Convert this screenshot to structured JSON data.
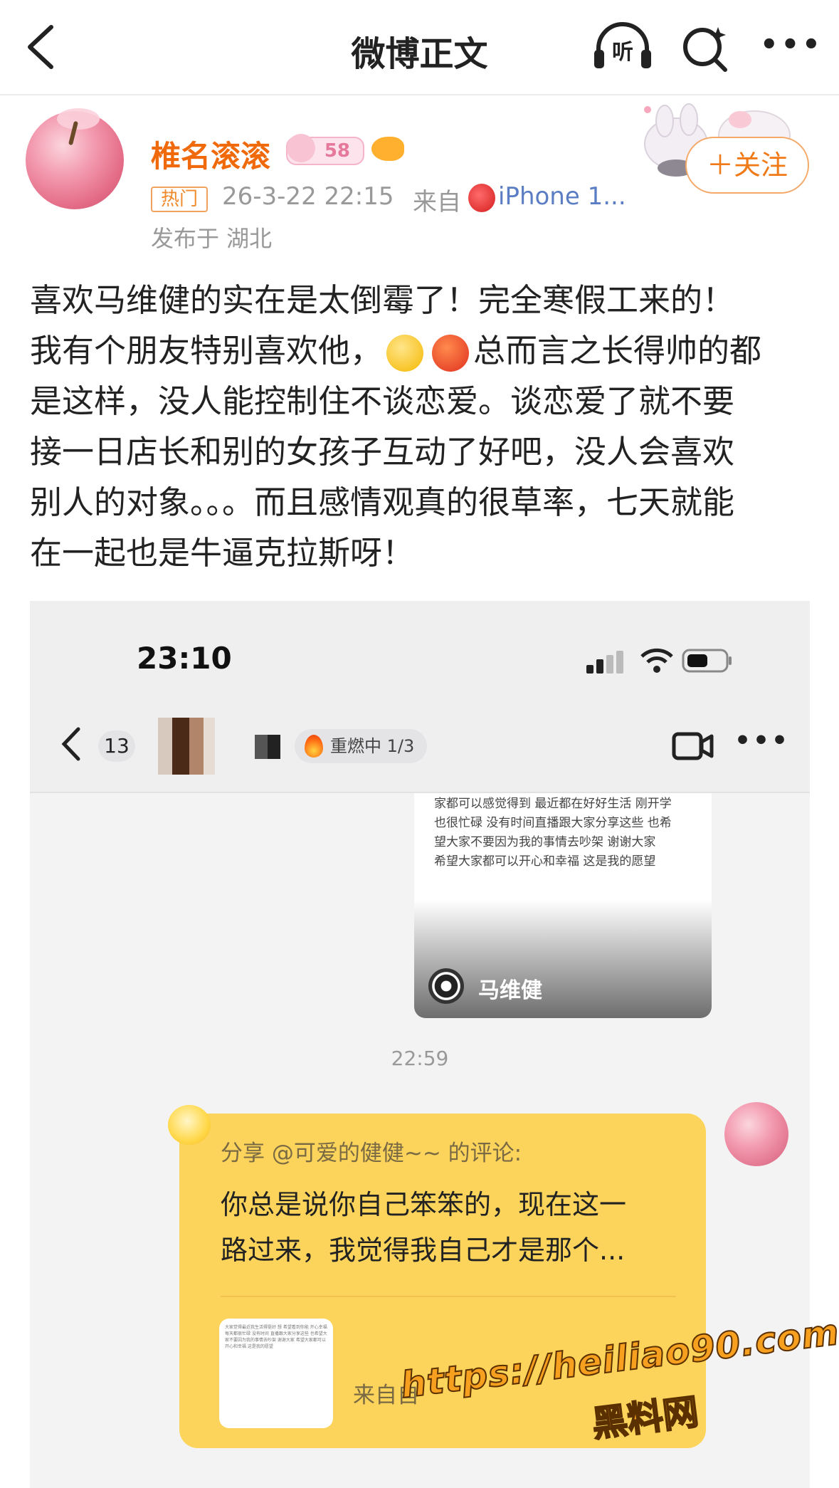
{
  "nav": {
    "title": "微博正文",
    "listen_label": "听"
  },
  "author": {
    "name": "椎名滚滚",
    "level_badge": "58",
    "hot_tag": "热门",
    "time": "26-3-22 22:15",
    "from_prefix": "来自",
    "device": "iPhone 1...",
    "location": "发布于 湖北",
    "follow_label": "＋关注"
  },
  "post": {
    "line1": "喜欢马维健的实在是太倒霉了！完全寒假工来的！",
    "line2_a": "我有个朋友特别喜欢他，",
    "line2_b": "总而言之长得帅的都",
    "line3": "是这样，没人能控制住不谈恋爱。谈恋爱了就不要",
    "line4": "接一日店长和别的女孩子互动了好吧，没人会喜欢",
    "line5": "别人的对象。。。而且感情观真的很草率，七天就能",
    "line6": "在一起也是牛逼克拉斯呀！"
  },
  "screenshot": {
    "status_time": "23:10",
    "chat_count": "13",
    "burn_label": "重燃中 1/3",
    "card1_text": "家都可以感觉得到 最近都在好好生活 刚开学\n也很忙碌 没有时间直播跟大家分享这些 也希\n望大家不要因为我的事情去吵架 谢谢大家\n希望大家都可以开心和幸福 这是我的愿望",
    "card1_name": "马维健",
    "time_divider": "22:59",
    "share_label": "分享 @可爱的健健~~ 的评论:",
    "share_quote": "你总是说你自己笨笨的，现在这一\n路过来，我觉得我自己才是那个...",
    "share_from": "来自自",
    "thumb_text": "大家觉得最近我生活得挺好 想 希望看到你能 开心幸福 每天都很忙碌 没有时间 直播跟大家分享这些 也希望大家不要因为我的事情去吵架 谢谢大家 希望大家都可以开心和幸福 这是我的愿望"
  },
  "watermark": {
    "url": "https://heiliao90.com",
    "name": "黑料网"
  },
  "colors": {
    "accent_orange": "#f06a0c",
    "link_blue": "#5b7dc4",
    "share_card_yellow": "#fcd45b"
  }
}
